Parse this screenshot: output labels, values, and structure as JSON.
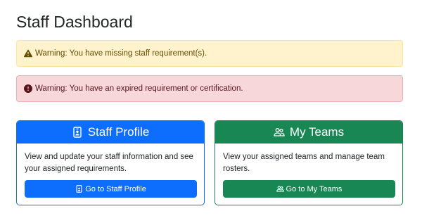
{
  "page": {
    "title": "Staff Dashboard"
  },
  "alerts": [
    {
      "type": "warning",
      "icon": "warning-triangle-icon",
      "text": "Warning: You have missing staff requirement(s).",
      "color": "#fff3cd"
    },
    {
      "type": "danger",
      "icon": "exclamation-circle-icon",
      "text": "Warning: You have an expired requirement or certification.",
      "color": "#f8d7da"
    }
  ],
  "cards": {
    "profile": {
      "title": "Staff Profile",
      "icon": "person-badge-icon",
      "text": "View and update your staff information and see your assigned requirements.",
      "button_label": "Go to Staff Profile",
      "accent": "#0d6efd"
    },
    "teams": {
      "title": "My Teams",
      "icon": "people-icon",
      "text": "View your assigned teams and manage team rosters.",
      "button_label": "Go to My Teams",
      "accent": "#198754"
    }
  }
}
